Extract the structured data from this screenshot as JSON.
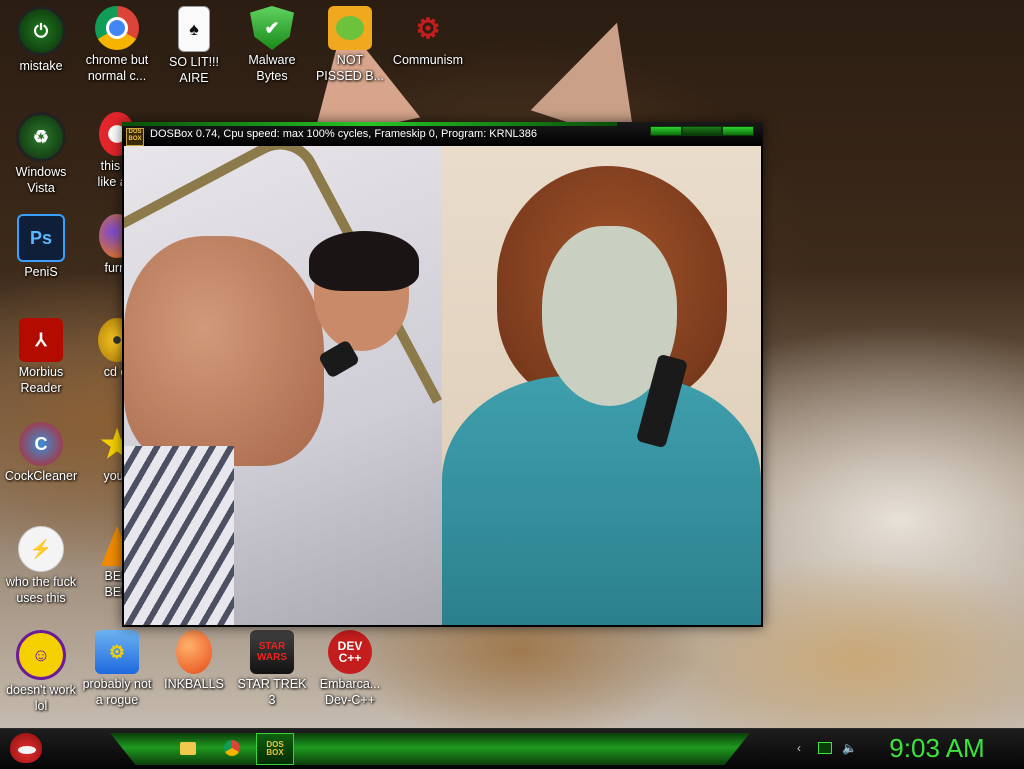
{
  "desktop": {
    "icons": [
      {
        "label": "mistake",
        "icon": "green-power-icon"
      },
      {
        "label": "chrome but\nnormal c...",
        "icon": "chrome-icon"
      },
      {
        "label": "SO LIT!!!\nAIRE",
        "icon": "solitaire-cards-icon"
      },
      {
        "label": "Malware\nBytes",
        "icon": "shield-check-icon"
      },
      {
        "label": "NOT\nPISSED B...",
        "icon": "green-pig-icon"
      },
      {
        "label": "Communism",
        "icon": "red-emblem-icon"
      },
      {
        "label": "Windows\nVista",
        "icon": "recycle-bin-icon"
      },
      {
        "label": "this lo\nlike a v",
        "icon": "opera-icon"
      },
      {
        "label": "PeniS",
        "icon": "photoshop-icon"
      },
      {
        "label": "furry",
        "icon": "firefox-icon"
      },
      {
        "label": "Morbius\nReader",
        "icon": "pdf-reader-icon"
      },
      {
        "label": "cd di",
        "icon": "cd-icon"
      },
      {
        "label": "CockCleaner",
        "icon": "ccleaner-icon"
      },
      {
        "label": "you t",
        "icon": "star-icon"
      },
      {
        "label": "who the fuck\nuses this",
        "icon": "lightning-icon"
      },
      {
        "label": "BEE\nBEE",
        "icon": "vlc-cone-icon"
      },
      {
        "label": "doesn't work\nlol",
        "icon": "yahoo-messenger-icon"
      },
      {
        "label": "probably not\na rogue",
        "icon": "gear-monitor-icon"
      },
      {
        "label": "INKBALLS",
        "icon": "inkball-icon"
      },
      {
        "label": "STAR TREK\n3",
        "icon": "star-trek-icon"
      },
      {
        "label": "Embarca...\nDev-C++",
        "icon": "dev-cpp-icon"
      }
    ]
  },
  "dosbox": {
    "title": "DOSBox 0.74, Cpu speed: max 100% cycles, Frameskip  0, Program:  KRNL386",
    "app_icon_text": "DOS\nBOX"
  },
  "taskbar": {
    "clock": "9:03 AM",
    "dos_label": "DOS\nBOX"
  },
  "colors": {
    "accent": "#2fd12f",
    "clock": "#3ee33e"
  }
}
